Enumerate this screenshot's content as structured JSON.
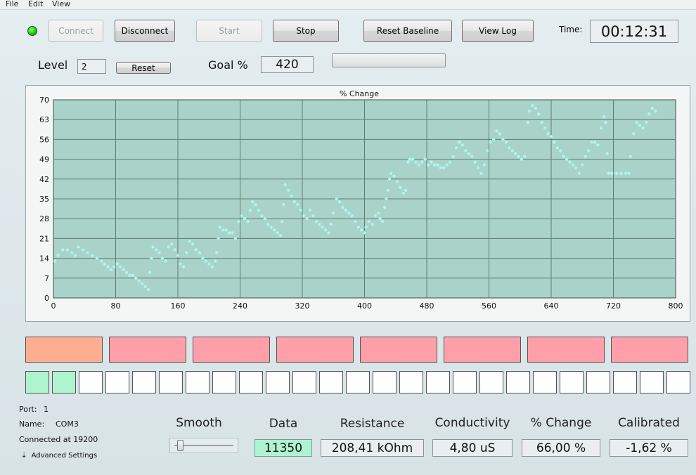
{
  "menu": [
    "File",
    "Edit",
    "View"
  ],
  "toolbar": {
    "connect_label": "Connect",
    "disconnect_label": "Disconnect",
    "start_label": "Start",
    "stop_label": "Stop",
    "reset_baseline_label": "Reset Baseline",
    "view_log_label": "View Log",
    "time_label": "Time:",
    "time_value": "00:12:31"
  },
  "level": {
    "label": "Level",
    "value": "2",
    "reset_label": "Reset"
  },
  "goal": {
    "label": "Goal %",
    "value": "420"
  },
  "status": {
    "connected_color": "#12b400"
  },
  "chart_data": {
    "type": "scatter",
    "title": "% Change",
    "xlim": [
      0,
      800
    ],
    "ylim": [
      0,
      70
    ],
    "xticks": [
      0,
      80,
      160,
      240,
      320,
      400,
      480,
      560,
      640,
      720,
      800
    ],
    "yticks": [
      0,
      7,
      14,
      21,
      28,
      35,
      42,
      49,
      56,
      63,
      70
    ],
    "grid": true,
    "marker_color": "#aef5f0",
    "plot_background": "#a9d2c8",
    "points": [
      [
        2,
        13
      ],
      [
        6,
        15
      ],
      [
        12,
        17
      ],
      [
        18,
        17
      ],
      [
        24,
        16
      ],
      [
        28,
        15
      ],
      [
        32,
        18
      ],
      [
        38,
        17
      ],
      [
        44,
        16
      ],
      [
        50,
        15
      ],
      [
        56,
        14
      ],
      [
        62,
        13
      ],
      [
        66,
        12
      ],
      [
        70,
        11
      ],
      [
        74,
        10
      ],
      [
        78,
        11
      ],
      [
        82,
        12
      ],
      [
        86,
        11
      ],
      [
        90,
        10
      ],
      [
        94,
        9
      ],
      [
        98,
        8
      ],
      [
        102,
        8
      ],
      [
        106,
        7
      ],
      [
        110,
        6
      ],
      [
        114,
        5
      ],
      [
        118,
        4
      ],
      [
        122,
        3
      ],
      [
        124,
        9
      ],
      [
        126,
        14
      ],
      [
        128,
        18
      ],
      [
        132,
        17
      ],
      [
        136,
        16
      ],
      [
        140,
        14
      ],
      [
        144,
        13
      ],
      [
        148,
        18
      ],
      [
        152,
        19
      ],
      [
        156,
        17
      ],
      [
        160,
        15
      ],
      [
        163,
        12
      ],
      [
        167,
        11
      ],
      [
        171,
        16
      ],
      [
        175,
        20
      ],
      [
        179,
        19
      ],
      [
        183,
        17
      ],
      [
        188,
        16
      ],
      [
        192,
        14
      ],
      [
        196,
        13
      ],
      [
        200,
        12
      ],
      [
        204,
        11
      ],
      [
        208,
        13
      ],
      [
        210,
        16
      ],
      [
        212,
        21
      ],
      [
        214,
        25
      ],
      [
        218,
        24
      ],
      [
        222,
        24
      ],
      [
        226,
        23
      ],
      [
        230,
        23
      ],
      [
        234,
        21
      ],
      [
        238,
        27
      ],
      [
        242,
        29
      ],
      [
        246,
        28
      ],
      [
        250,
        27
      ],
      [
        253,
        31
      ],
      [
        256,
        34
      ],
      [
        260,
        33
      ],
      [
        264,
        31
      ],
      [
        268,
        29
      ],
      [
        272,
        28
      ],
      [
        276,
        26
      ],
      [
        280,
        25
      ],
      [
        284,
        24
      ],
      [
        288,
        23
      ],
      [
        292,
        22
      ],
      [
        294,
        27
      ],
      [
        296,
        33
      ],
      [
        298,
        40
      ],
      [
        302,
        38
      ],
      [
        306,
        36
      ],
      [
        310,
        34
      ],
      [
        314,
        33
      ],
      [
        318,
        31
      ],
      [
        322,
        29
      ],
      [
        326,
        28
      ],
      [
        330,
        31
      ],
      [
        334,
        29
      ],
      [
        338,
        27
      ],
      [
        342,
        26
      ],
      [
        346,
        25
      ],
      [
        350,
        24
      ],
      [
        354,
        23
      ],
      [
        357,
        26
      ],
      [
        360,
        30
      ],
      [
        364,
        35
      ],
      [
        368,
        34
      ],
      [
        372,
        32
      ],
      [
        376,
        31
      ],
      [
        380,
        30
      ],
      [
        384,
        29
      ],
      [
        388,
        27
      ],
      [
        392,
        25
      ],
      [
        396,
        24
      ],
      [
        400,
        23
      ],
      [
        402,
        25
      ],
      [
        406,
        27
      ],
      [
        410,
        26
      ],
      [
        414,
        29
      ],
      [
        418,
        30
      ],
      [
        420,
        28
      ],
      [
        423,
        27
      ],
      [
        426,
        32
      ],
      [
        428,
        35
      ],
      [
        430,
        38
      ],
      [
        432,
        42
      ],
      [
        434,
        44
      ],
      [
        438,
        43
      ],
      [
        442,
        41
      ],
      [
        446,
        39
      ],
      [
        450,
        37
      ],
      [
        453,
        38
      ],
      [
        456,
        48
      ],
      [
        458,
        49
      ],
      [
        462,
        49
      ],
      [
        466,
        48
      ],
      [
        470,
        47
      ],
      [
        474,
        48
      ],
      [
        478,
        49
      ],
      [
        482,
        47
      ],
      [
        486,
        48
      ],
      [
        490,
        47
      ],
      [
        494,
        47
      ],
      [
        498,
        46
      ],
      [
        502,
        46
      ],
      [
        506,
        47
      ],
      [
        510,
        48
      ],
      [
        514,
        50
      ],
      [
        518,
        53
      ],
      [
        522,
        55
      ],
      [
        526,
        54
      ],
      [
        530,
        52
      ],
      [
        534,
        51
      ],
      [
        538,
        50
      ],
      [
        542,
        48
      ],
      [
        546,
        46
      ],
      [
        550,
        44
      ],
      [
        554,
        47
      ],
      [
        558,
        52
      ],
      [
        562,
        55
      ],
      [
        566,
        56
      ],
      [
        570,
        59
      ],
      [
        574,
        58
      ],
      [
        578,
        56
      ],
      [
        582,
        55
      ],
      [
        586,
        53
      ],
      [
        590,
        52
      ],
      [
        594,
        51
      ],
      [
        598,
        50
      ],
      [
        602,
        49
      ],
      [
        606,
        50
      ],
      [
        610,
        62
      ],
      [
        612,
        66
      ],
      [
        616,
        68
      ],
      [
        620,
        67
      ],
      [
        624,
        65
      ],
      [
        628,
        62
      ],
      [
        632,
        60
      ],
      [
        636,
        58
      ],
      [
        640,
        57
      ],
      [
        644,
        55
      ],
      [
        648,
        53
      ],
      [
        652,
        52
      ],
      [
        656,
        50
      ],
      [
        660,
        49
      ],
      [
        664,
        48
      ],
      [
        668,
        47
      ],
      [
        672,
        46
      ],
      [
        676,
        44
      ],
      [
        680,
        47
      ],
      [
        684,
        50
      ],
      [
        688,
        52
      ],
      [
        692,
        55
      ],
      [
        696,
        55
      ],
      [
        700,
        54
      ],
      [
        704,
        60
      ],
      [
        708,
        64
      ],
      [
        710,
        62
      ],
      [
        712,
        51
      ],
      [
        714,
        44
      ],
      [
        718,
        44
      ],
      [
        724,
        44
      ],
      [
        730,
        44
      ],
      [
        736,
        44
      ],
      [
        740,
        44
      ],
      [
        742,
        50
      ],
      [
        746,
        58
      ],
      [
        750,
        62
      ],
      [
        754,
        61
      ],
      [
        758,
        60
      ],
      [
        762,
        62
      ],
      [
        766,
        65
      ],
      [
        770,
        67
      ],
      [
        774,
        66
      ]
    ]
  },
  "blocks_top": [
    {
      "color": "#ffad90"
    },
    {
      "color": "#ff9fa9"
    },
    {
      "color": "#ff9fa9"
    },
    {
      "color": "#ff9fa9"
    },
    {
      "color": "#ff9fa9"
    },
    {
      "color": "#ff9fa9"
    },
    {
      "color": "#ff9fa9"
    },
    {
      "color": "#ff9fa9"
    }
  ],
  "blocks_small_count": 25,
  "blocks_small_on": [
    0,
    1
  ],
  "connection": {
    "port_label": "Port:",
    "port_value": "1",
    "name_label": "Name:",
    "name_value": "COM3",
    "connected_text": "Connected at 19200",
    "advanced_label": "Advanced Settings"
  },
  "smooth": {
    "label": "Smooth",
    "value": 0.05
  },
  "readouts": {
    "data": {
      "label": "Data",
      "value": "11350"
    },
    "resistance": {
      "label": "Resistance",
      "value": "208,41 kOhm"
    },
    "conductivity": {
      "label": "Conductivity",
      "value": "4,80 uS"
    },
    "change": {
      "label": "% Change",
      "value": "66,00 %"
    },
    "calibrated": {
      "label": "Calibrated",
      "value": "-1,62 %"
    }
  },
  "colors": {
    "data_highlight": "#aef5cf"
  }
}
